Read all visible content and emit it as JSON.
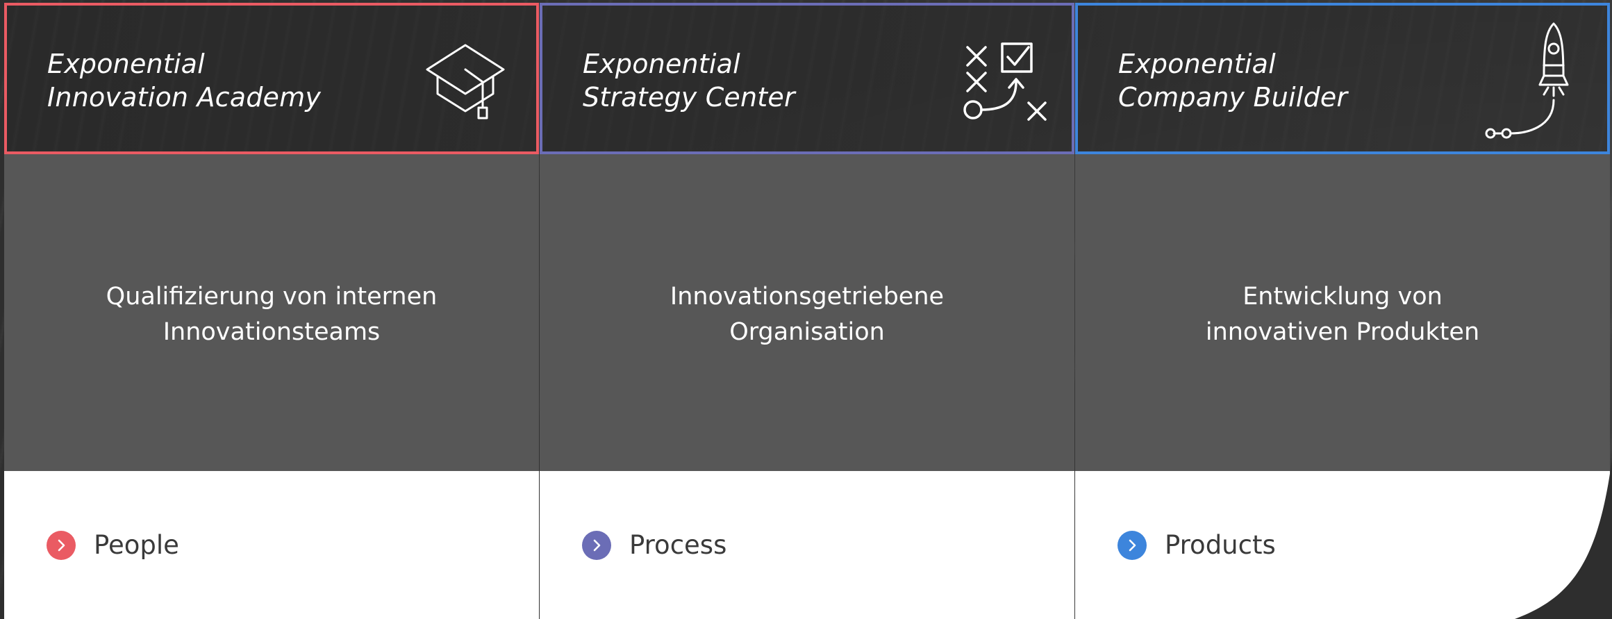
{
  "colors": {
    "academy_accent": "#ea5b63",
    "strategy_accent": "#6b6db6",
    "builder_accent": "#3d85dc",
    "background": "#2b2b2b",
    "panel": "#575757"
  },
  "columns": [
    {
      "title_line1": "Exponential",
      "title_line2": "Innovation Academy",
      "icon": "graduation-cap-icon",
      "desc_line1": "Qualifizierung von internen",
      "desc_line2": "Innovationsteams",
      "tag": "People"
    },
    {
      "title_line1": "Exponential",
      "title_line2": "Strategy Center",
      "icon": "strategy-play-icon",
      "desc_line1": "Innovationsgetriebene",
      "desc_line2": "Organisation",
      "tag": "Process"
    },
    {
      "title_line1": "Exponential",
      "title_line2": "Company Builder",
      "icon": "rocket-icon",
      "desc_line1": "Entwicklung von",
      "desc_line2": "innovativen Produkten",
      "tag": "Products"
    }
  ]
}
